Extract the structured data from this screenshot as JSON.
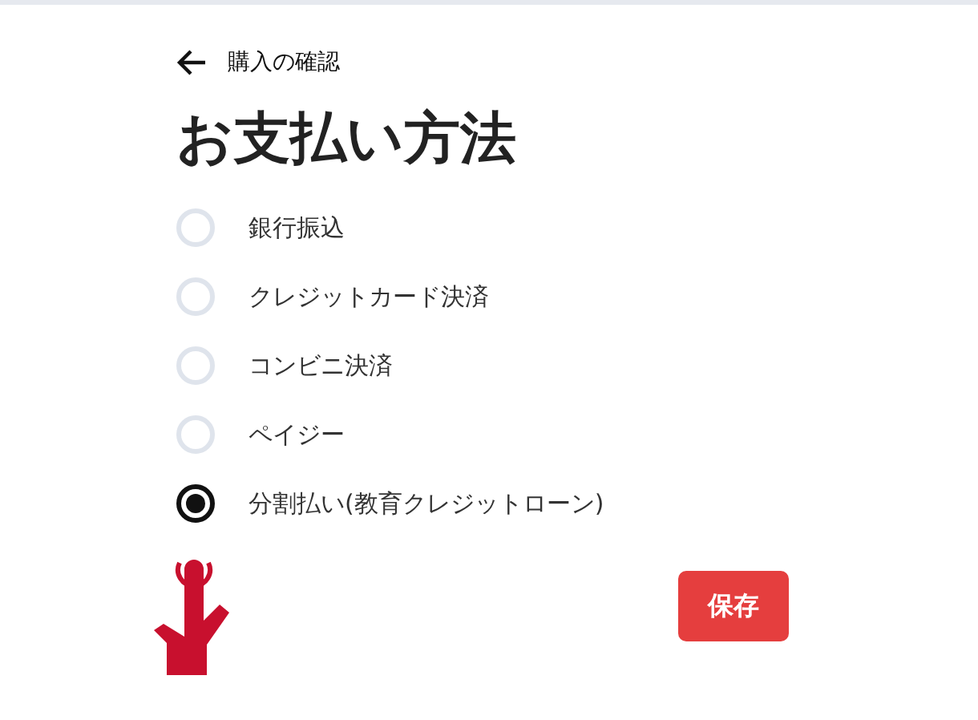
{
  "back_link": {
    "label": "購入の確認"
  },
  "title": "お支払い方法",
  "options": [
    {
      "label": "銀行振込",
      "selected": false
    },
    {
      "label": "クレジットカード決済",
      "selected": false
    },
    {
      "label": "コンビニ決済",
      "selected": false
    },
    {
      "label": "ペイジー",
      "selected": false
    },
    {
      "label": "分割払い(教育クレジットローン)",
      "selected": true
    }
  ],
  "save_button": {
    "label": "保存"
  }
}
